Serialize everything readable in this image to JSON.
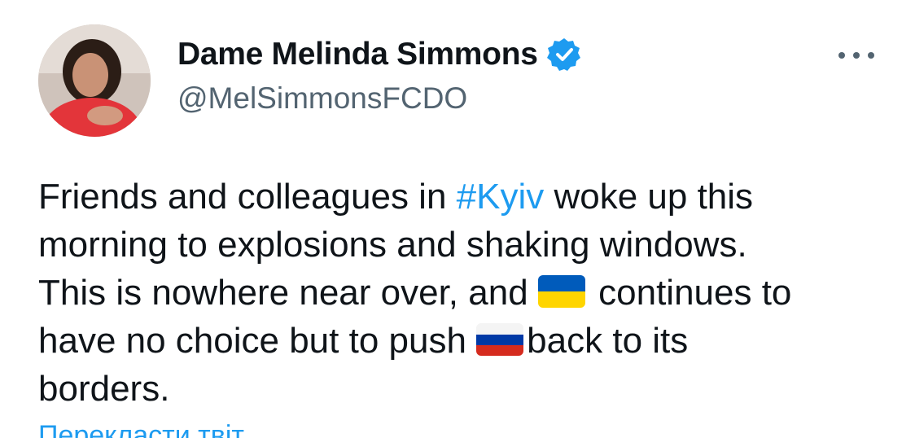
{
  "author": {
    "display_name": "Dame Melinda Simmons",
    "handle": "@MelSimmonsFCDO",
    "verified": true,
    "avatar_icon": "profile-photo"
  },
  "tweet": {
    "line1_a": "Friends and colleagues in ",
    "hashtag": "#Kyiv",
    "line1_b": " woke up this",
    "line2": "morning to explosions and shaking windows.",
    "line3_a": "This is nowhere near over, and ",
    "line3_b": " continues to",
    "line4_a": "have no choice but to push ",
    "line4_b": "back to its",
    "line5": "borders.",
    "flag_1": "ukraine-flag",
    "flag_2": "russia-flag"
  },
  "translate_link": "Перекласти твіт",
  "more_icon": "more-horizontal-icon",
  "colors": {
    "link": "#1d9bf0",
    "text": "#0f1419",
    "secondary": "#536471",
    "ukraine_blue": "#005bbb",
    "ukraine_yellow": "#ffd500",
    "russia_white": "#ffffff",
    "russia_blue": "#0039a6",
    "russia_red": "#d52b1e"
  }
}
